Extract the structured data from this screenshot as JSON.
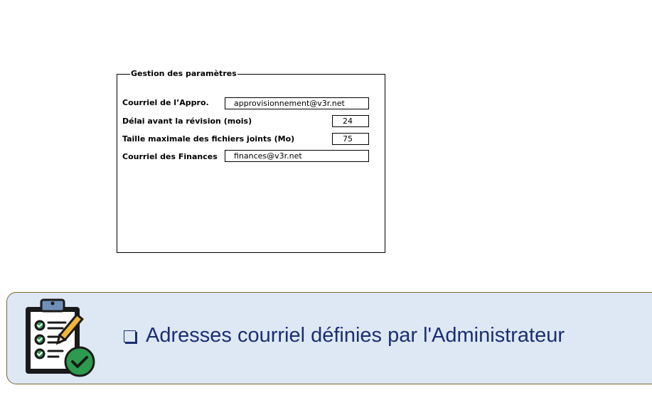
{
  "panel": {
    "legend": "Gestion des paramètres",
    "rows": [
      {
        "label": "Courriel de l’Appro.",
        "value": "approvisionnement@v3r.net"
      },
      {
        "label": "Délai avant la révision (mois)",
        "value": "24"
      },
      {
        "label": "Taille maximale des fichiers joints (Mo)",
        "value": "75"
      },
      {
        "label": "Courriel des Finances",
        "value": "finances@v3r.net"
      }
    ]
  },
  "note": {
    "text": "Adresses courriel définies par l'Administrateur",
    "icon": "clipboard-checklist-icon",
    "colors": {
      "background": "#dde8f4",
      "border": "#7a6a2a",
      "text": "#1b2e73",
      "check": "#2e9a4e"
    }
  }
}
